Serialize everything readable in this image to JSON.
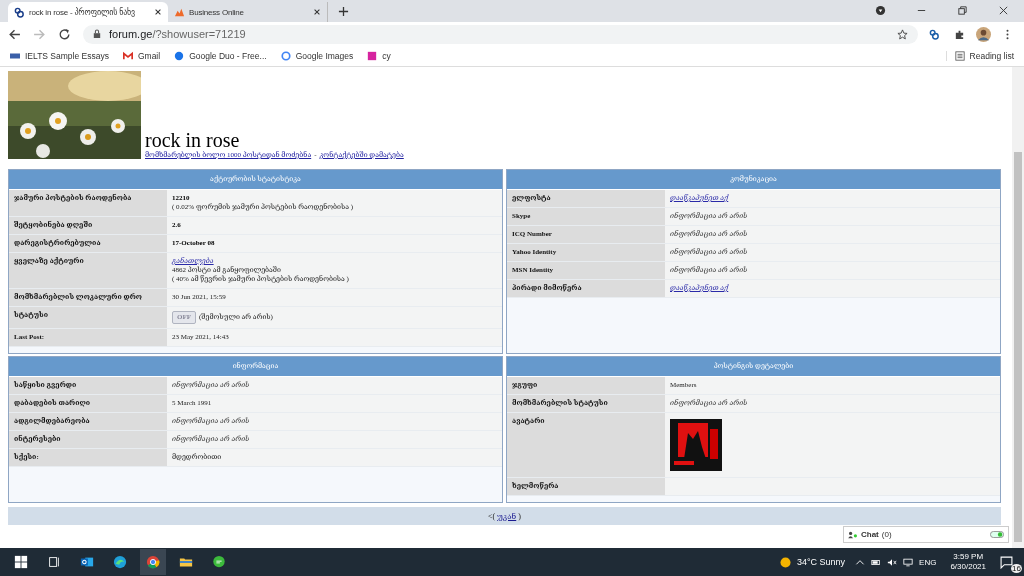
{
  "browser": {
    "tabs": [
      {
        "title": "rock in rose - პროფილის ნახვ",
        "selected": true
      },
      {
        "title": "Business Online",
        "selected": false
      }
    ],
    "address": {
      "host": "forum.ge",
      "path": "/?showuser=71219"
    },
    "bookmarks": [
      "IELTS Sample Essays",
      "Gmail",
      "Google Duo - Free...",
      "Google Images",
      "cy"
    ],
    "reading_list": "Reading list"
  },
  "profile": {
    "name": "rock in rose",
    "links": [
      "მომხმარებლის ბოლო 1000 პოსტიდან მოძებნა",
      "კონტაქტებში დამატება"
    ],
    "separator": "-"
  },
  "panels": [
    {
      "title": "აქტიურობის სტატისტიკა",
      "rows": [
        {
          "label": "ჯამური პოსტების რაოდენობა",
          "values": [
            {
              "kind": "bold",
              "text": "12210"
            },
            {
              "kind": "plain",
              "text": "( 0.02% ფორუმის ჯამური პოსტების რაოდენობისა )"
            }
          ]
        },
        {
          "label": "შეტყობინება დღეში",
          "values": [
            {
              "kind": "bold",
              "text": "2.6"
            }
          ]
        },
        {
          "label": "დარეგისტრირებულია",
          "values": [
            {
              "kind": "bold",
              "text": "17-October 08"
            }
          ]
        },
        {
          "label": "ყველაზე აქტიური",
          "values": [
            {
              "kind": "link",
              "text": "განათლება"
            },
            {
              "kind": "plain",
              "text": "4862 პოსტი ამ განყოფილებაში"
            },
            {
              "kind": "plain",
              "text": "( 40% ამ წევრის ჯამური პოსტების რაოდენობისა )"
            }
          ]
        },
        {
          "label": "მომხმარებლის ლოკალური დრო",
          "values": [
            {
              "kind": "plain",
              "text": "30 Jun 2021, 15:59"
            }
          ]
        },
        {
          "label": "სტატუსი",
          "values": [
            {
              "kind": "status",
              "badge": "OFF",
              "online": false,
              "text": "(შემოსული არ არის)"
            }
          ]
        },
        {
          "label": "Last Post:",
          "values": [
            {
              "kind": "plain",
              "text": "23 May 2021, 14:43"
            }
          ]
        }
      ]
    },
    {
      "title": "კომუნიკაცია",
      "rows": [
        {
          "label": "ელფოსტა",
          "values": [
            {
              "kind": "link",
              "text": "დააწკაპუნეთ აქ"
            }
          ]
        },
        {
          "label": "Skype",
          "values": [
            {
              "kind": "italic",
              "text": "ინფორმაცია არ არის"
            }
          ]
        },
        {
          "label": "ICQ Number",
          "values": [
            {
              "kind": "italic",
              "text": "ინფორმაცია არ არის"
            }
          ]
        },
        {
          "label": "Yahoo Identity",
          "values": [
            {
              "kind": "italic",
              "text": "ინფორმაცია არ არის"
            }
          ]
        },
        {
          "label": "MSN Identity",
          "values": [
            {
              "kind": "italic",
              "text": "ინფორმაცია არ არის"
            }
          ]
        },
        {
          "label": "პირადი მიმოწერა",
          "values": [
            {
              "kind": "link",
              "text": "დააწკაპუნეთ აქ"
            }
          ]
        }
      ]
    },
    {
      "title": "ინფორმაცია",
      "rows": [
        {
          "label": "საწყისი გვერდი",
          "values": [
            {
              "kind": "italic",
              "text": "ინფორმაცია არ არის"
            }
          ]
        },
        {
          "label": "დაბადების თარიღი",
          "values": [
            {
              "kind": "plain",
              "text": "5 March 1991"
            }
          ]
        },
        {
          "label": "ადგილმდებარეობა",
          "values": [
            {
              "kind": "italic",
              "text": "ინფორმაცია არ არის"
            }
          ]
        },
        {
          "label": "ინტერესები",
          "values": [
            {
              "kind": "italic",
              "text": "ინფორმაცია არ არის"
            }
          ]
        },
        {
          "label": "სქესი:",
          "values": [
            {
              "kind": "plain",
              "text": "მდედრობითი"
            }
          ]
        }
      ]
    },
    {
      "title": "პოსტინგის დეტალები",
      "rows": [
        {
          "label": "ჯგუფი",
          "values": [
            {
              "kind": "plain",
              "text": "Members"
            }
          ]
        },
        {
          "label": "მომხმარებლის სტატუსი",
          "values": [
            {
              "kind": "italic",
              "text": "ინფორმაცია არ არის"
            }
          ]
        },
        {
          "label": "ავატარი"
        },
        {
          "label": "ხელმოწერა"
        }
      ]
    }
  ],
  "back": {
    "prefix": "<(",
    "link": "უკან",
    "suffix": ")"
  },
  "chat": {
    "label": "Chat",
    "count": "(0)"
  },
  "taskbar": {
    "weather": "34°C Sunny",
    "language": "ENG",
    "time": "3:59 PM",
    "date": "6/30/2021",
    "notifications": "16"
  }
}
